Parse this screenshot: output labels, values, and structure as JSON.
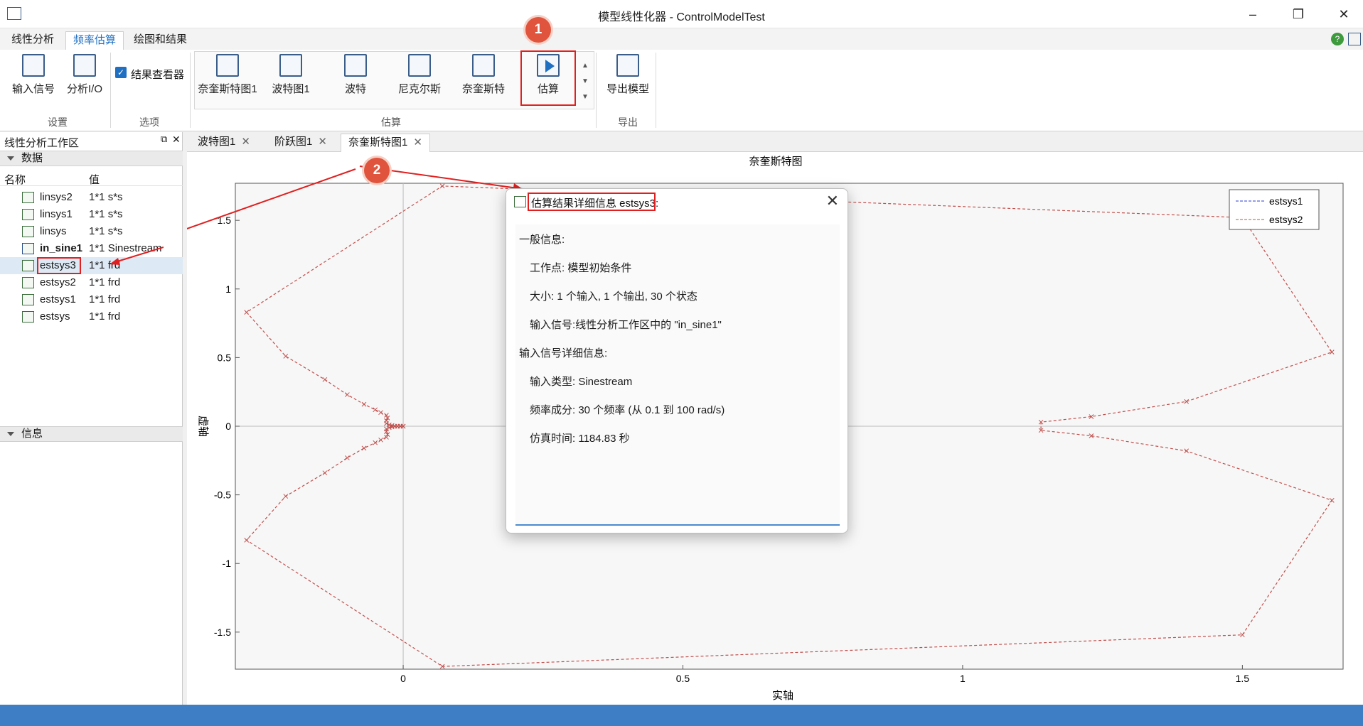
{
  "window": {
    "title": "模型线性化器 - ControlModelTest"
  },
  "ribbon_tabs": [
    "线性分析",
    "频率估算",
    "绘图和结果"
  ],
  "ribbon": {
    "settings": {
      "input_signal": "输入信号",
      "analysis_io": "分析I/O",
      "group": "设置"
    },
    "options": {
      "result_viewer": "结果查看器",
      "group": "选项"
    },
    "plots": [
      "奈奎斯特图1",
      "波特图1",
      "波特",
      "尼克尔斯",
      "奈奎斯特"
    ],
    "estimate": {
      "label": "估算",
      "group": "估算"
    },
    "export": {
      "label": "导出模型",
      "group": "导出"
    }
  },
  "annotations": {
    "badge1": "1",
    "badge2": "2"
  },
  "workspace": {
    "title": "线性分析工作区",
    "data_section": "数据",
    "info_section": "信息",
    "col_name": "名称",
    "col_value": "值",
    "variables": [
      {
        "name": "linsys2",
        "value": "1*1 s*s"
      },
      {
        "name": "linsys1",
        "value": "1*1 s*s"
      },
      {
        "name": "linsys",
        "value": "1*1 s*s"
      },
      {
        "name": "in_sine1",
        "value": "1*1 Sinestream"
      },
      {
        "name": "estsys3",
        "value": "1*1 frd"
      },
      {
        "name": "estsys2",
        "value": "1*1 frd"
      },
      {
        "name": "estsys1",
        "value": "1*1 frd"
      },
      {
        "name": "estsys",
        "value": "1*1 frd"
      }
    ]
  },
  "doc_tabs": [
    "波特图1",
    "阶跃图1",
    "奈奎斯特图1"
  ],
  "chart_data": {
    "type": "line",
    "title": "奈奎斯特图",
    "xlabel": "实轴",
    "ylabel": "虚轴",
    "xlim": [
      -0.3,
      1.68
    ],
    "ylim": [
      -1.77,
      1.77
    ],
    "xticks": [
      0,
      0.5,
      1,
      1.5
    ],
    "yticks": [
      -1.5,
      -1,
      -0.5,
      0,
      0.5,
      1,
      1.5
    ],
    "legend": "top-right",
    "series": [
      {
        "name": "estsys1",
        "color": "#2b3fd6",
        "x": [],
        "y": []
      },
      {
        "name": "estsys2",
        "color": "#c0504d",
        "x": [
          0,
          -0.005,
          -0.01,
          -0.015,
          -0.02,
          -0.025,
          -0.03,
          -0.03,
          -0.028,
          -0.03,
          -0.04,
          -0.05,
          -0.07,
          -0.1,
          -0.14,
          -0.21,
          -0.28,
          0.07,
          1.5,
          1.66,
          1.4,
          1.23,
          1.14,
          1.14,
          1.23,
          1.4,
          1.66,
          1.5,
          0.07,
          -0.28,
          -0.21,
          -0.14,
          -0.1,
          -0.07,
          -0.05,
          -0.04,
          -0.03,
          -0.028,
          -0.03,
          -0.03,
          -0.025,
          -0.02,
          -0.015,
          -0.01,
          -0.005,
          0
        ],
        "y": [
          0,
          0,
          0,
          0,
          0.005,
          0.01,
          0.02,
          0.04,
          0.06,
          0.08,
          0.1,
          0.12,
          0.16,
          0.23,
          0.34,
          0.51,
          0.83,
          1.75,
          1.52,
          0.54,
          0.18,
          0.07,
          0.03,
          -0.03,
          -0.07,
          -0.18,
          -0.54,
          -1.52,
          -1.75,
          -0.83,
          -0.51,
          -0.34,
          -0.23,
          -0.16,
          -0.12,
          -0.1,
          -0.08,
          -0.06,
          -0.04,
          -0.02,
          -0.01,
          -0.005,
          0,
          0,
          0,
          0
        ]
      }
    ]
  },
  "dialog": {
    "title": "估算结果详细信息 estsys3",
    "title_suffix": ":",
    "general": "一般信息:",
    "operating_point": "工作点:   模型初始条件",
    "size": "大小:   1 个输入,  1 个输出,  30 个状态",
    "input_signal": "输入信号:线性分析工作区中的 \"in_sine1\"",
    "input_detail": "输入信号详细信息:",
    "input_type": "输入类型:   Sinestream",
    "frequency": "频率成分:   30 个频率 (从 0.1 到 100 rad/s)",
    "sim_time": "仿真时间:   1184.83 秒"
  }
}
